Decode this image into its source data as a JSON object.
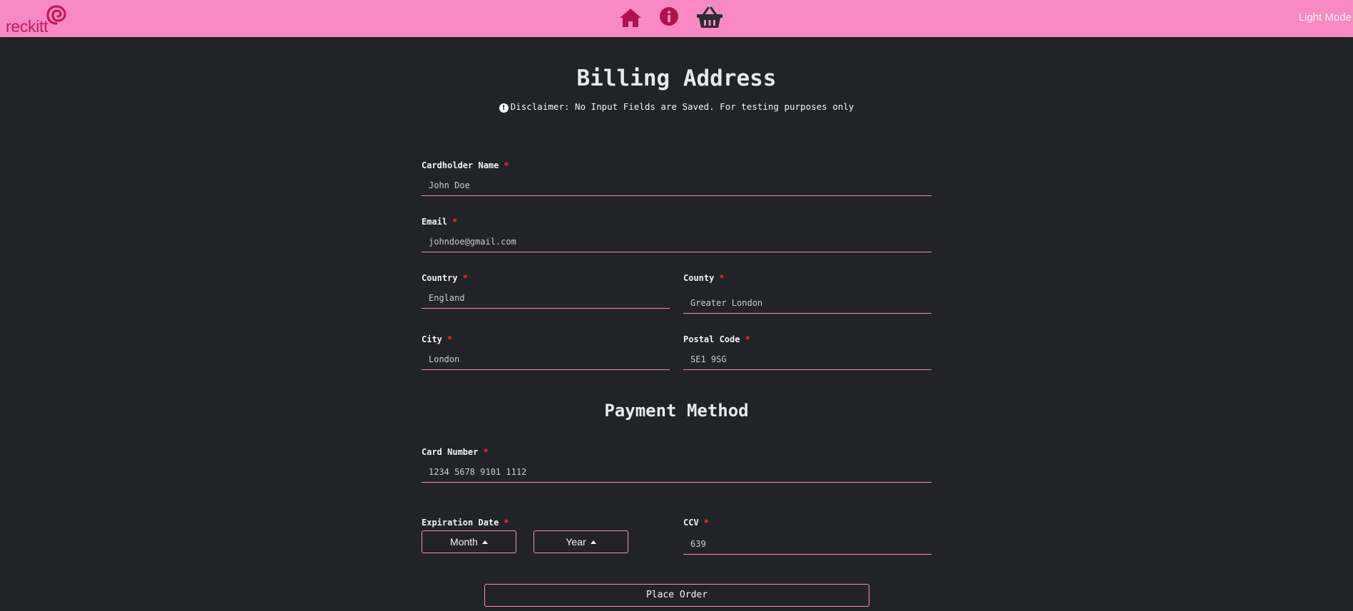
{
  "header": {
    "logo_text": "reckitt",
    "nav_icons": [
      "home-icon",
      "info-icon",
      "basket-icon"
    ],
    "mode_toggle_label": "Light Mode",
    "background_color": "#f989c4",
    "icon_color": "#b0124f"
  },
  "billing": {
    "title": "Billing Address",
    "disclaimer": "Disclaimer: No Input Fields are Saved. For testing purposes only",
    "fields": {
      "cardholder_name": {
        "label": "Cardholder Name",
        "value": "John Doe"
      },
      "email": {
        "label": "Email",
        "value": "johndoe@gmail.com"
      },
      "country": {
        "label": "Country",
        "value": "England"
      },
      "county": {
        "label": "County",
        "value": "Greater London"
      },
      "city": {
        "label": "City",
        "value": "London"
      },
      "postal_code": {
        "label": "Postal Code",
        "value": "SE1 9SG"
      }
    }
  },
  "payment": {
    "title": "Payment Method",
    "fields": {
      "card_number": {
        "label": "Card Number",
        "value": "1234 5678 9101 1112"
      },
      "expiration_date": {
        "label": "Expiration Date"
      },
      "ccv": {
        "label": "CCV",
        "value": "639"
      }
    },
    "month_button": "Month",
    "year_button": "Year",
    "place_order": "Place Order"
  },
  "required_marker": "*",
  "colors": {
    "background": "#212329",
    "accent": "#f48fb1",
    "required": "#ff2b2b"
  }
}
